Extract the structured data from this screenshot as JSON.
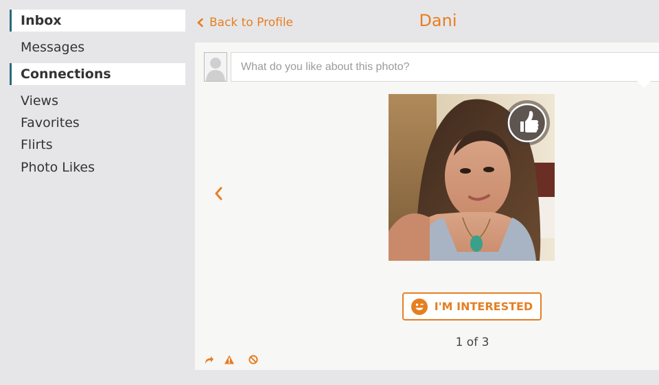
{
  "sidebar": {
    "items": [
      {
        "label": "Inbox",
        "section": true
      },
      {
        "label": "Messages",
        "section": false
      },
      {
        "label": "Connections",
        "section": true
      },
      {
        "label": "Views",
        "section": false
      },
      {
        "label": "Favorites",
        "section": false
      },
      {
        "label": "Flirts",
        "section": false
      },
      {
        "label": "Photo Likes",
        "section": false
      }
    ]
  },
  "header": {
    "back_label": "Back to Profile",
    "profile_name": "Dani"
  },
  "comment": {
    "placeholder": "What do you like about this photo?",
    "value": ""
  },
  "photo": {
    "current": 1,
    "total": 3,
    "counter_text": "1 of 3"
  },
  "actions": {
    "interested_label": "I'M INTERESTED"
  },
  "icons": [
    "chevron-left-icon",
    "user-silhouette-icon",
    "thumbs-up-icon",
    "smiley-icon",
    "share-icon",
    "warning-icon",
    "block-icon"
  ],
  "colors": {
    "accent": "#e67e22",
    "section_marker": "#2a6b78",
    "background": "#e6e6e8",
    "panel": "#f7f7f5"
  }
}
